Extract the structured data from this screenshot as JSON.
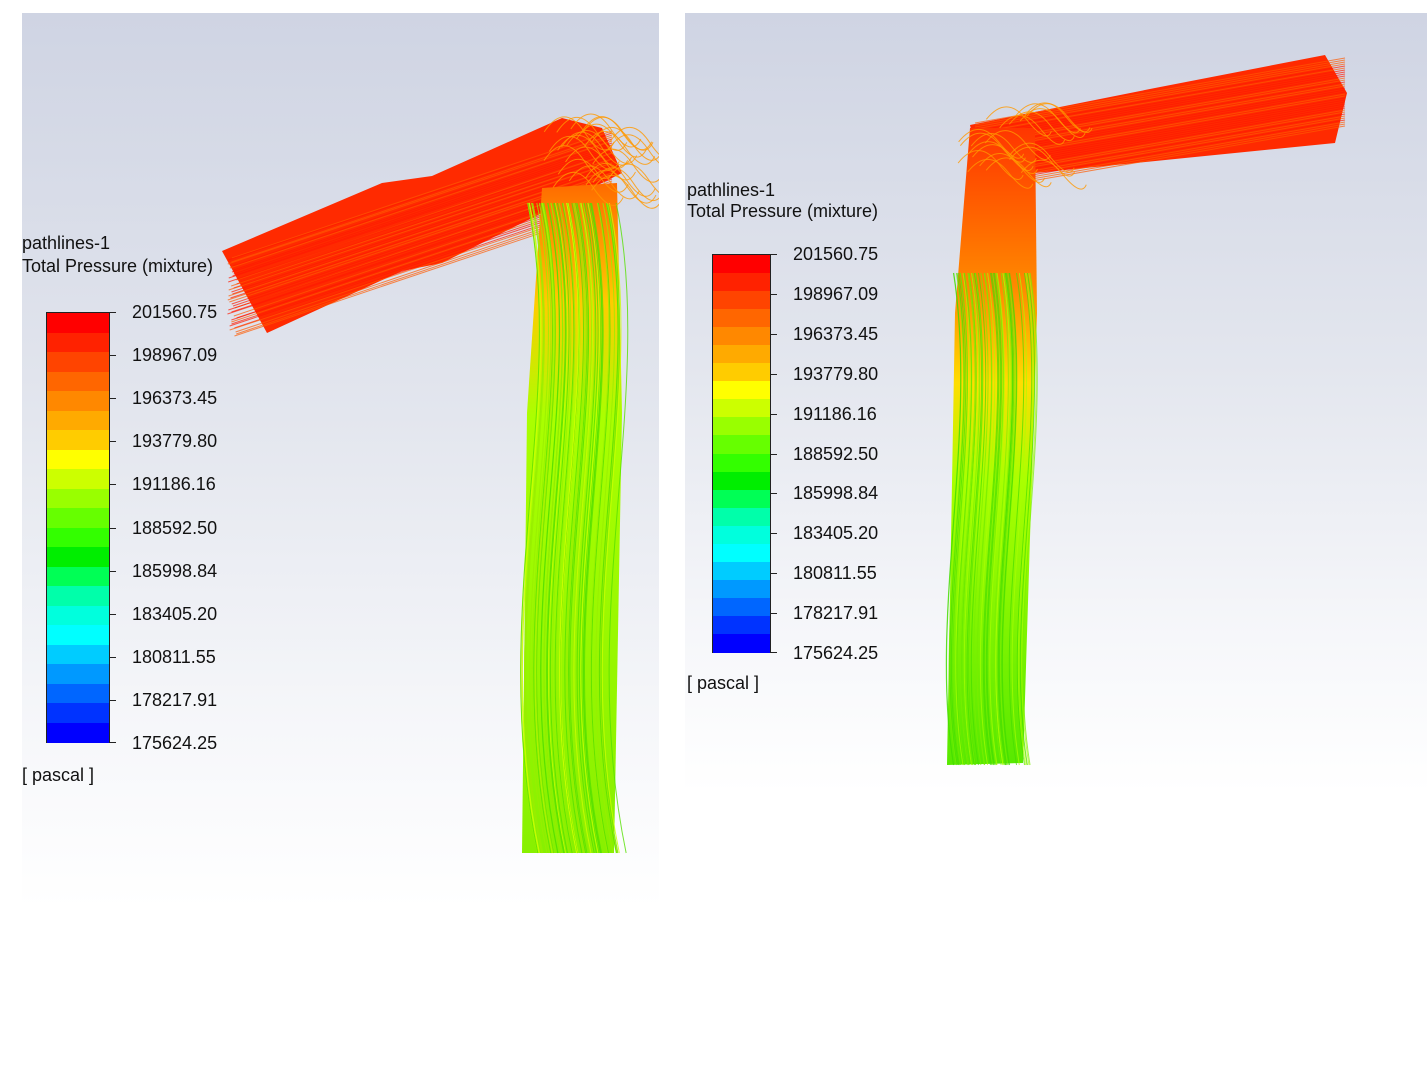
{
  "panels": [
    {
      "legend_name": "pathlines-1",
      "variable": "Total Pressure (mixture)",
      "unit": "[ pascal ]",
      "scale_values": [
        "201560.75",
        "198967.09",
        "196373.45",
        "193779.80",
        "191186.16",
        "188592.50",
        "185998.84",
        "183405.20",
        "180811.55",
        "178217.91",
        "175624.25"
      ]
    },
    {
      "legend_name": "pathlines-1",
      "variable": "Total Pressure (mixture)",
      "unit": "[ pascal ]",
      "scale_values": [
        "201560.75",
        "198967.09",
        "196373.45",
        "193779.80",
        "191186.16",
        "188592.50",
        "185998.84",
        "183405.20",
        "180811.55",
        "178217.91",
        "175624.25"
      ]
    }
  ],
  "colormap": [
    "#ff0000",
    "#ff2200",
    "#ff4400",
    "#ff6600",
    "#ff8800",
    "#ffaa00",
    "#ffcc00",
    "#ffff00",
    "#ccff00",
    "#99ff00",
    "#66ff00",
    "#33ff00",
    "#00ee00",
    "#00ff55",
    "#00ffaa",
    "#00ffdd",
    "#00ffff",
    "#00ccff",
    "#0099ff",
    "#0066ff",
    "#0033ff",
    "#0000ff"
  ]
}
